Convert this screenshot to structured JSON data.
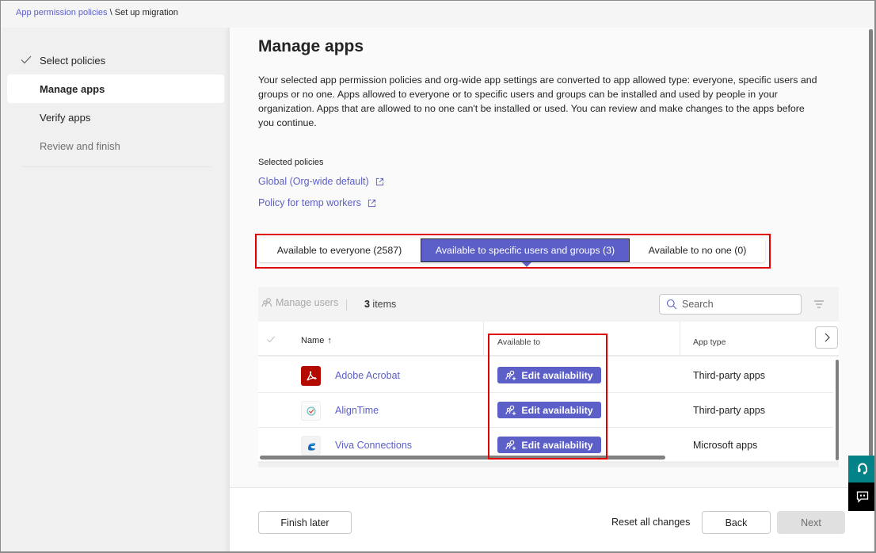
{
  "breadcrumb": {
    "parent": "App permission policies",
    "separator": " \\ ",
    "current": "Set up migration"
  },
  "steps": [
    {
      "label": "Select policies",
      "state": "completed",
      "icon": "checkmark-icon"
    },
    {
      "label": "Manage apps",
      "state": "active"
    },
    {
      "label": "Verify apps",
      "state": "pending"
    },
    {
      "label": "Review and finish",
      "state": "disabled"
    }
  ],
  "main": {
    "title": "Manage apps",
    "description": "Your selected app permission policies and org-wide app settings are converted to app allowed type: everyone, specific users and groups or no one. Apps allowed to everyone or to specific users and groups can be installed and used by people in your organization. Apps that are allowed to no one can't be installed or used. You can review and make changes to the apps before you continue.",
    "selected_policies_label": "Selected policies",
    "policies": [
      {
        "label": "Global (Org-wide default)",
        "icon": "external-link-icon"
      },
      {
        "label": "Policy for temp workers",
        "icon": "external-link-icon"
      }
    ],
    "tabs": [
      {
        "label": "Available to everyone (2587)",
        "selected": false
      },
      {
        "label": "Available to specific users and groups (3)",
        "selected": true
      },
      {
        "label": "Available to no one (0)",
        "selected": false
      }
    ]
  },
  "table": {
    "toolbar": {
      "manage_users_label": "Manage users",
      "items_count": "3",
      "items_suffix": " items",
      "search_placeholder": "Search"
    },
    "columns": {
      "name": "Name",
      "name_sort": "↑",
      "available_to": "Available to",
      "app_type": "App type"
    },
    "rows": [
      {
        "name": "Adobe Acrobat",
        "action": "Edit availability",
        "app_type": "Third-party apps",
        "icon": "adobe-acrobat-icon"
      },
      {
        "name": "AlignTime",
        "action": "Edit availability",
        "app_type": "Third-party apps",
        "icon": "aligntime-icon"
      },
      {
        "name": "Viva Connections",
        "action": "Edit availability",
        "app_type": "Microsoft apps",
        "icon": "viva-connections-icon"
      }
    ]
  },
  "footer": {
    "finish_later": "Finish later",
    "reset_all": "Reset all changes",
    "back": "Back",
    "next": "Next"
  },
  "colors": {
    "accent": "#5b5fc7",
    "highlight": "#e00000",
    "help_pill": "#038387"
  }
}
